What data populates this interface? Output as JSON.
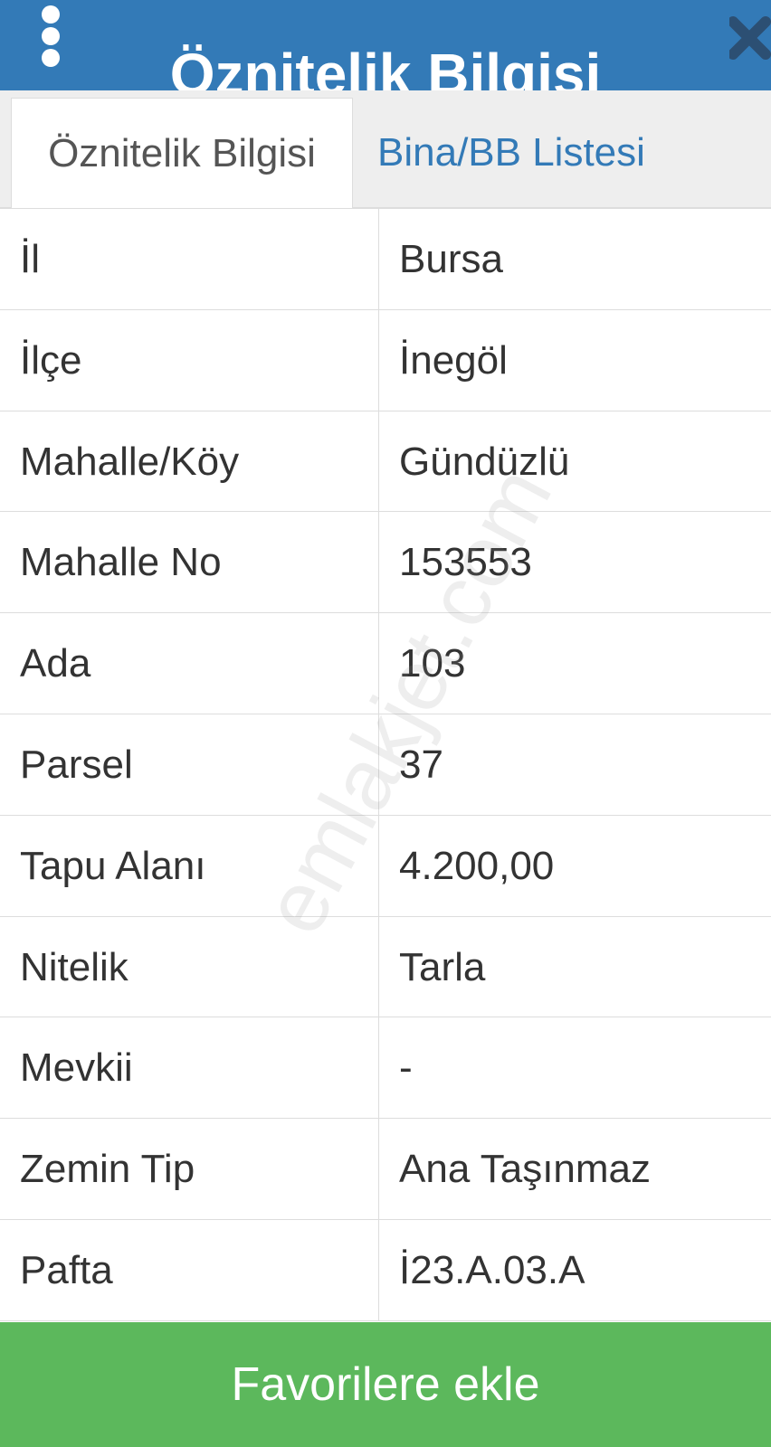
{
  "header": {
    "title": "Öznitelik Bilgisi",
    "menu_icon": "more-vertical-icon",
    "close_icon": "close-icon"
  },
  "tabs": [
    {
      "label": "Öznitelik Bilgisi",
      "active": true
    },
    {
      "label": "Bina/BB Listesi",
      "active": false
    }
  ],
  "rows": [
    {
      "label": "İl",
      "value": "Bursa"
    },
    {
      "label": "İlçe",
      "value": "İnegöl"
    },
    {
      "label": "Mahalle/Köy",
      "value": "Gündüzlü"
    },
    {
      "label": "Mahalle No",
      "value": "153553"
    },
    {
      "label": "Ada",
      "value": "103"
    },
    {
      "label": "Parsel",
      "value": "37"
    },
    {
      "label": "Tapu Alanı",
      "value": "4.200,00"
    },
    {
      "label": "Nitelik",
      "value": "Tarla"
    },
    {
      "label": "Mevkii",
      "value": "-"
    },
    {
      "label": "Zemin Tip",
      "value": "Ana Taşınmaz"
    },
    {
      "label": "Pafta",
      "value": "İ23.A.03.A"
    }
  ],
  "watermark": "emlakjet.com",
  "footer": {
    "favorite_label": "Favorilere ekle"
  },
  "colors": {
    "header": "#337ab7",
    "tab_link": "#337ab7",
    "button": "#5cb85c",
    "close_icon": "#2c4f73"
  }
}
